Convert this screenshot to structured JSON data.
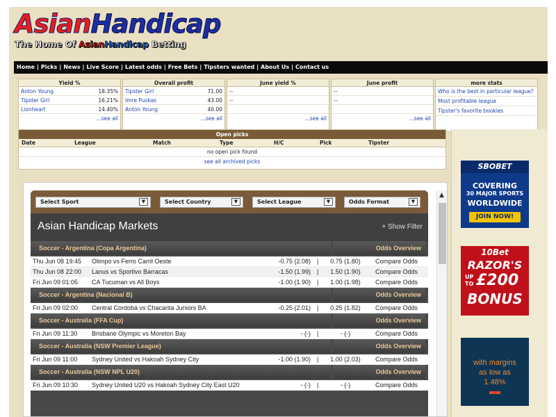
{
  "logo": {
    "line1_part1": "Asian",
    "line1_part2": "Handicap",
    "line2_pre": "The Home Of ",
    "line2_red": "Asian",
    "line2_blue": "Handicap",
    "line2_post": " Betting"
  },
  "nav": [
    "Home",
    "Picks",
    "News",
    "Live Score",
    "Latest odds",
    "Free Bets",
    "Tipsters wanted",
    "About Us",
    "Contact us"
  ],
  "stats": {
    "yield": {
      "title": "Yield %",
      "rows": [
        {
          "name": "Anton Young",
          "value": "18.35%"
        },
        {
          "name": "Tipster Girl",
          "value": "16.21%"
        },
        {
          "name": "Lionheart",
          "value": "14.40%"
        }
      ],
      "more": "...see all"
    },
    "overall": {
      "title": "Overall profit",
      "rows": [
        {
          "name": "Tipster Girl",
          "value": "71.00"
        },
        {
          "name": "Imre Puskas",
          "value": "43.00"
        },
        {
          "name": "Anton Young",
          "value": "40.00"
        }
      ],
      "more": "...see all"
    },
    "june_yield": {
      "title": "June yield %",
      "rows": [
        {
          "name": "--"
        },
        {
          "name": "--"
        },
        {
          "name": ""
        }
      ],
      "more": "...see all"
    },
    "june_profit": {
      "title": "June profit",
      "rows": [
        {
          "name": "--"
        },
        {
          "name": "--"
        },
        {
          "name": ""
        }
      ],
      "more": "...see all"
    },
    "more_stats": {
      "title": "more stats",
      "links": [
        "Who is the best in particular league?",
        "Most profitable league",
        "Tipster's favorite bookies"
      ]
    }
  },
  "open_picks": {
    "title": "Open picks",
    "columns": [
      "Date",
      "League",
      "Match",
      "Type",
      "H/C",
      "Pick",
      "Tipster"
    ],
    "empty": "no open pick found",
    "archive": "see all archived picks"
  },
  "market": {
    "selects": [
      "Select Sport",
      "Select Country",
      "Select League",
      "Odds Format"
    ],
    "title": "Asian Handicap Markets",
    "show_filter": "+ Show Filter",
    "odds_overview": "Odds Overview",
    "leagues": [
      {
        "name": "Soccer - Argentina (Copa Argentina)",
        "matches": [
          {
            "time": "Thu Jun 08 19:45",
            "teams": "Olimpo vs Ferro Carril Oeste",
            "home": "-0.75 (2.08)",
            "away": "0.75 (1.80)",
            "compare": "Compare Odds"
          },
          {
            "time": "Thu Jun 08 22:00",
            "teams": "Lanus vs Sportivo Barracas",
            "home": "-1.50 (1.99)",
            "away": "1.50 (1.90)",
            "compare": "Compare Odds"
          },
          {
            "time": "Fri Jun 09 01:05",
            "teams": "CA Tucuman vs All Boys",
            "home": "-1.00 (1.90)",
            "away": "1.00 (1.98)",
            "compare": "Compare Odds"
          }
        ]
      },
      {
        "name": "Soccer - Argentina (Nacional B)",
        "matches": [
          {
            "time": "Fri Jun 09 02:00",
            "teams": "Central Cordoba vs Chacarita Juniors BA",
            "home": "-0.25 (2.01)",
            "away": "0.25 (1.82)",
            "compare": "Compare Odds"
          }
        ]
      },
      {
        "name": "Soccer - Australia (FFA Cup)",
        "matches": [
          {
            "time": "Fri Jun 09 11:30",
            "teams": "Brisbane Olympic vs Moreton Bay",
            "home": "- (-)",
            "away": "- (-)",
            "compare": "Compare Odds"
          }
        ]
      },
      {
        "name": "Soccer - Australia (NSW Premier League)",
        "matches": [
          {
            "time": "Fri Jun 09 11:00",
            "teams": "Sydney United vs Hakoah Sydney City",
            "home": "-1.00 (1.90)",
            "away": "1.00 (2.03)",
            "compare": "Compare Odds"
          }
        ]
      },
      {
        "name": "Soccer - Australia (NSW NPL U20)",
        "matches": [
          {
            "time": "Fri Jun 09 10:30",
            "teams": "Sydney United U20 vs Hakoah Sydney City East U20",
            "home": "- (-)",
            "away": "- (-)",
            "compare": "Compare Odds"
          }
        ]
      }
    ]
  },
  "ads": {
    "sbobet": {
      "brand": "SBOBET",
      "l1": "COVERING",
      "l2": "30 MAJOR SPORTS",
      "l3": "WORLDWIDE",
      "cta": "JOIN NOW!"
    },
    "tenbet": {
      "brand": "10Bet",
      "l1": "RAZOR'S",
      "l2": "UP",
      "l3": "TO",
      "amount": "£200",
      "l4": "BONUS"
    },
    "margins": {
      "l1": "with margins",
      "l2": "as low as",
      "l3": "1.48%"
    }
  }
}
